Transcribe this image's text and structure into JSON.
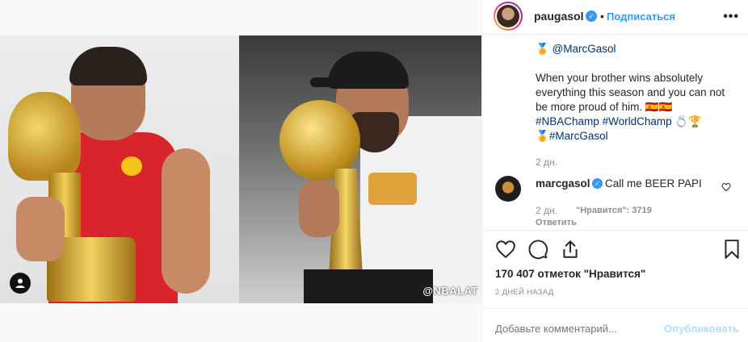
{
  "header": {
    "username": "paugasol",
    "follow_label": "Подписаться",
    "separator": "•",
    "more_label": "•••"
  },
  "post": {
    "watermark": "@NBALAT",
    "caption_line1_prefix": "🏅",
    "caption_mention1": "@MarcGasol",
    "caption_text": "When your brother wins absolutely everything this season and you can not be more proud of him. 🇪🇸🇪🇸",
    "hashtag1": "#NBAChamp",
    "hashtag2": "#WorldChamp",
    "caption_emojis": "💍🏆",
    "caption_line_end_prefix": "🏅",
    "hashtag3": "#MarcGasol",
    "caption_time": "2 дн."
  },
  "comment": {
    "username": "marcgasol",
    "text": "Call me BEER PAPI",
    "time": "2 дн.",
    "likes": "\"Нравится\": 3719",
    "reply_label": "Ответить"
  },
  "actions": {
    "likes_count": "170 407 отметок \"Нравится\"",
    "date": "2 ДНЕЙ НАЗАД"
  },
  "comment_box": {
    "placeholder": "Добавьте комментарий...",
    "post_label": "Опубликовать"
  },
  "colors": {
    "accent": "#3897f0",
    "link": "#003569",
    "muted": "#8e8e8e"
  },
  "icons": [
    "heart-icon",
    "comment-icon",
    "share-icon",
    "bookmark-icon",
    "verified-icon",
    "user-tag-icon",
    "more-icon"
  ]
}
